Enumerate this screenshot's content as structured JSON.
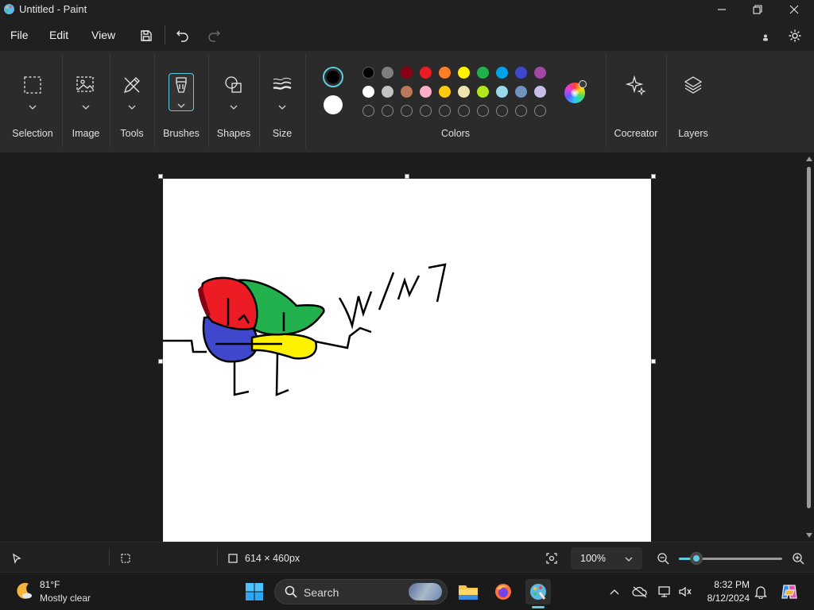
{
  "window": {
    "title": "Untitled - Paint"
  },
  "menu": {
    "file": "File",
    "edit": "Edit",
    "view": "View"
  },
  "ribbon": {
    "groups": {
      "selection": "Selection",
      "image": "Image",
      "tools": "Tools",
      "brushes": "Brushes",
      "shapes": "Shapes",
      "size": "Size",
      "colors": "Colors",
      "cocreator": "Cocreator",
      "layers": "Layers"
    },
    "primary_color": "#000000",
    "secondary_color": "#ffffff",
    "palette_row1": [
      "#000000",
      "#7f7f7f",
      "#880015",
      "#ed1c24",
      "#ff7f27",
      "#fff200",
      "#22b14c",
      "#00a2e8",
      "#3f48cc",
      "#a349a4"
    ],
    "palette_row2": [
      "#ffffff",
      "#c3c3c3",
      "#b97a57",
      "#ffaec9",
      "#ffc90e",
      "#efe4b0",
      "#b5e61d",
      "#99d9ea",
      "#7092be",
      "#c8bfe7"
    ],
    "palette_row3_empty_slots": 10
  },
  "status": {
    "canvas_size": "614 × 460px",
    "zoom": "100%",
    "zoom_slider_fraction": 0.17
  },
  "taskbar": {
    "weather_temp": "81°F",
    "weather_desc": "Mostly clear",
    "search_label": "Search",
    "time": "8:32 PM",
    "date": "8/12/2024"
  },
  "accent_color": "#60cdda"
}
